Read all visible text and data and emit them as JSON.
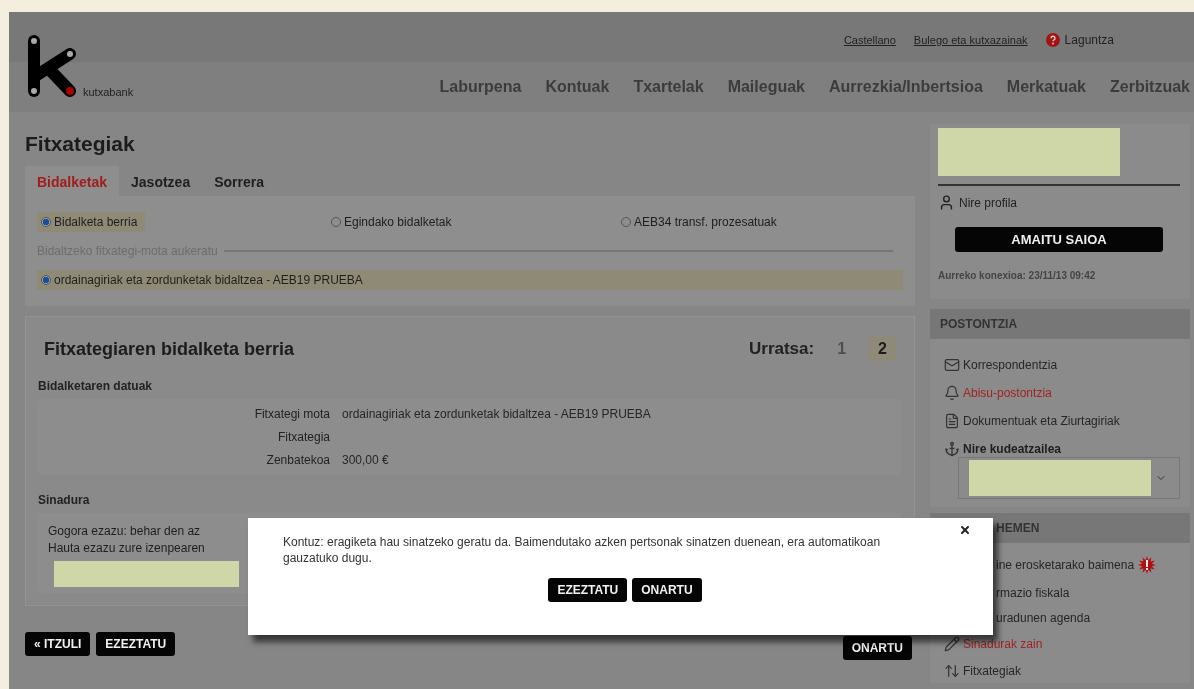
{
  "top_links": [
    {
      "label": "Castellano",
      "kind": "link"
    },
    {
      "label": "Bulego eta kutxazainak",
      "kind": "link"
    },
    {
      "label": "Laguntza",
      "kind": "help"
    }
  ],
  "logo": {
    "text": "kutxabank"
  },
  "nav": [
    "Laburpena",
    "Kontuak",
    "Txartelak",
    "Maileguak",
    "Aurrezkia/Inbertsioa",
    "Merkatuak",
    "Zerbitzuak"
  ],
  "page_title": "Fitxategiak",
  "tabs": [
    {
      "label": "Bidalketak",
      "selected": true
    },
    {
      "label": "Jasotzea",
      "selected": false
    },
    {
      "label": "Sorrera",
      "selected": false
    }
  ],
  "send_options": [
    {
      "label": "Bidalketa berria",
      "selected": true
    },
    {
      "label": "Egindako bidalketak",
      "selected": false
    },
    {
      "label": "AEB34 transf. prozesatuak",
      "selected": false
    }
  ],
  "file_type": {
    "legend": "Bidaltzeko fitxategi-mota aukeratu",
    "options": [
      {
        "label": "ordainagiriak eta zordunketak bidaltzea - AEB19 PRUEBA",
        "selected": true
      }
    ]
  },
  "wizard": {
    "title": "Fitxategiaren bidalketa berria",
    "step_label": "Urratsa:",
    "steps": [
      {
        "label": "1",
        "selected": false
      },
      {
        "label": "2",
        "selected": true
      }
    ],
    "data_heading": "Bidalketaren datuak",
    "fields": [
      {
        "label": "Fitxategi mota",
        "value": "ordainagiriak eta zordunketak bidaltzea - AEB19 PRUEBA"
      },
      {
        "label": "Fitxategia"
      },
      {
        "label": "Zenbatekoa",
        "value": "300,00 €"
      }
    ],
    "signature_heading": "Sinadura",
    "signature_lines": [
      "Gogora ezazu: behar den az",
      "Hauta ezazu zure izenpearen"
    ]
  },
  "actions": [
    {
      "label": "« ITZULI",
      "kind": "left"
    },
    {
      "label": "EZEZTATU",
      "kind": "left"
    },
    {
      "label": "ONARTU",
      "kind": "right"
    }
  ],
  "modal": {
    "message": "Kontuz: eragiketa hau sinatzeko geratu da. Baimendutako azken pertsonak sinatzen duenean, era automatikoan gauzatuko dugu.",
    "buttons": [
      "EZEZTATU",
      "ONARTU"
    ]
  },
  "sidebar": {
    "profile_link": "Nire profila",
    "logout": "AMAITU SAIOA",
    "last_login": "Aurreko konexioa: 23/11/13 09:42",
    "mailbox": {
      "title": "POSTONTZIA",
      "items": [
        {
          "label": "Korrespondentzia",
          "kind": "mail",
          "alert": false
        },
        {
          "label": "Abisu-postontzia",
          "kind": "bell",
          "alert": true
        },
        {
          "label": "Dokumentuak eta Ziurtagiriak",
          "kind": "doc",
          "alert": false
        }
      ]
    },
    "manager": "Nire kudeatzailea",
    "here": {
      "title": "HEMEN",
      "items": [
        {
          "label": "ine erosketarako baimena",
          "kind": "covered",
          "alert": false,
          "badge": true
        },
        {
          "label": "rmazio fiskala",
          "kind": "covered",
          "alert": false,
          "badge": false
        },
        {
          "label": "uradunen agenda",
          "kind": "covered",
          "alert": false,
          "badge": false
        },
        {
          "label": "Sinadurak zain",
          "kind": "pen",
          "alert": true,
          "badge": false
        },
        {
          "label": "Fitxategiak",
          "kind": "arrows",
          "alert": false,
          "badge": false
        }
      ]
    }
  }
}
